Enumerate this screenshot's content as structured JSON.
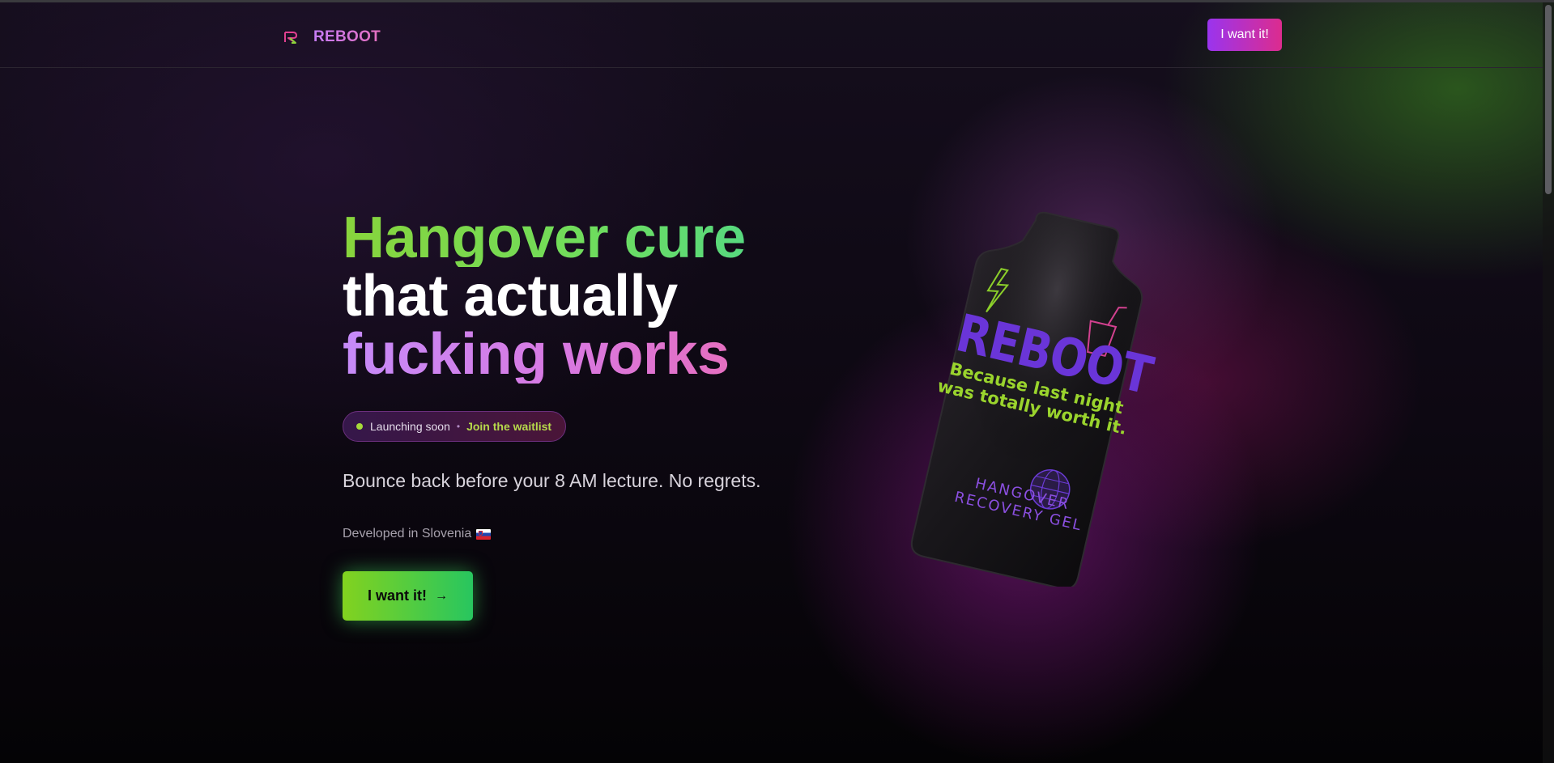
{
  "header": {
    "logo_text": "REBOOT",
    "logo_icon": "reboot-r-icon",
    "cta_label": "I want it!"
  },
  "hero": {
    "headline_line1": "Hangover cure",
    "headline_line2": "that actually",
    "headline_line3": "fucking works",
    "pill": {
      "status": "Launching soon",
      "separator": "•",
      "link": "Join the waitlist"
    },
    "subtitle": "Bounce back before your 8 AM lecture. No regrets.",
    "developed": "Developed in Slovenia",
    "cta_label": "I want it!",
    "cta_arrow": "→"
  },
  "product": {
    "brand": "REBOOT",
    "tagline": "Because last night was totally worth it.",
    "type": "HANGOVER RECOVERY GEL",
    "icons": [
      "lightning-icon",
      "drink-cup-icon",
      "globe-icon"
    ]
  },
  "colors": {
    "accent_purple": "#9a34ee",
    "accent_pink": "#dc2c8e",
    "accent_green": "#82d21f",
    "background": "#07050a"
  }
}
